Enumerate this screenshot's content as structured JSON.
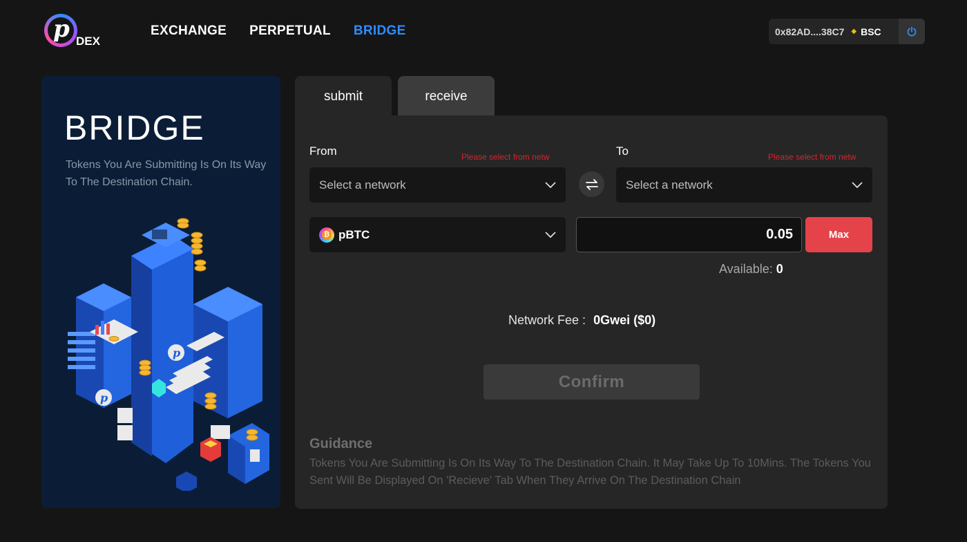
{
  "logo": {
    "letter": "p",
    "text": "DEX"
  },
  "nav": {
    "items": [
      "EXCHANGE",
      "PERPETUAL",
      "BRIDGE"
    ],
    "active": "BRIDGE"
  },
  "wallet": {
    "address": "0x82AD....38C7",
    "network": "BSC",
    "network_color": "#f0b90b"
  },
  "hero": {
    "title": "BRIDGE",
    "subtitle": "Tokens You Are Submitting Is On Its Way To The Destination Chain."
  },
  "tabs": {
    "submit": "submit",
    "receive": "receive",
    "active": "submit"
  },
  "form": {
    "from": {
      "label": "From",
      "error": "Please select from netw",
      "placeholder": "Select a network"
    },
    "to": {
      "label": "To",
      "error": "Please select from netw",
      "placeholder": "Select a network"
    },
    "token": {
      "name": "pBTC",
      "icon": "bitcoin-icon"
    },
    "amount": "0.05",
    "max_label": "Max",
    "available_label": "Available:",
    "available_value": "0",
    "fee_label": "Network Fee :",
    "fee_value": "0Gwei ($0)",
    "confirm_label": "Confirm"
  },
  "guidance": {
    "title": "Guidance",
    "text": "Tokens You Are Submitting Is On Its Way To The Destination Chain. It May Take Up To 10Mins. The Tokens You Sent Will Be Displayed On 'Recieve' Tab When They Arrive On The Destination Chain"
  },
  "colors": {
    "accent": "#2f8cff",
    "max_button": "#e5434a",
    "error": "#d8242c"
  }
}
